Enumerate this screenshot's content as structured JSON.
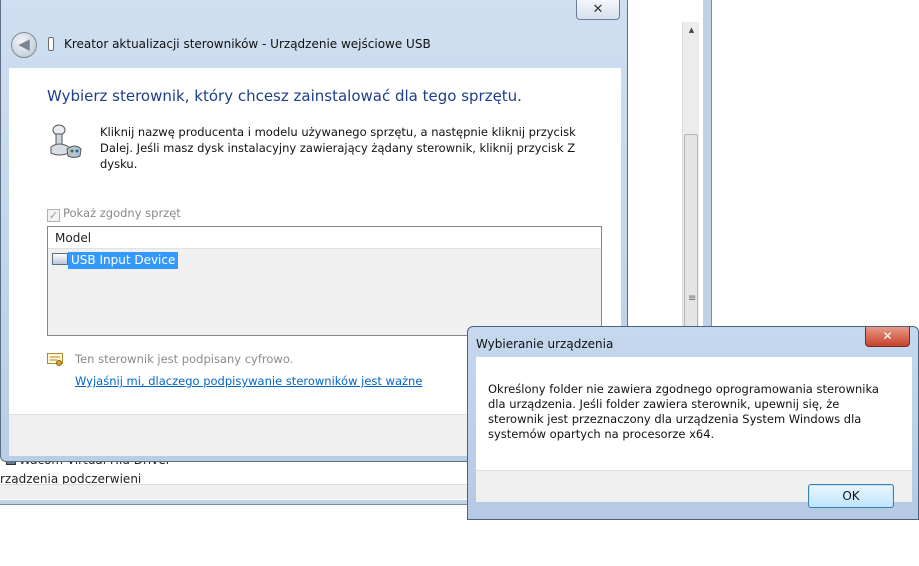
{
  "background_window": {
    "row_1": "Wacom Virtual Hid Driver",
    "row_2": "rządzenia podczerwieni",
    "scroll_up": "▲",
    "scroll_grip": "≡"
  },
  "wizard": {
    "title": "Kreator aktualizacji sterowników - Urządzenie wejściowe USB",
    "close_glyph": "✕",
    "back_glyph": "◀",
    "heading": "Wybierz sterownik, który chcesz zainstalować dla tego sprzętu.",
    "instructions": "Kliknij nazwę producenta i modelu używanego sprzętu, a następnie kliknij przycisk Dalej. Jeśli masz dysk instalacyjny zawierający żądany sterownik, kliknij przycisk Z dysku.",
    "compatible_checkbox_label": "Pokaż zgodny sprzęt",
    "compatible_checked_glyph": "✓",
    "model_list": {
      "header": "Model",
      "items": [
        "USB Input Device"
      ]
    },
    "signed_text": "Ten sterownik jest podpisany cyfrowo.",
    "signing_link": "Wyjaśnij mi, dlaczego podpisywanie sterowników jest ważne"
  },
  "dialog": {
    "title": "Wybieranie urządzenia",
    "close_glyph": "✕",
    "message": "Określony folder nie zawiera zgodnego oprogramowania sterownika dla urządzenia. Jeśli folder zawiera sterownik, upewnij się, że sterownik jest przeznaczony dla urządzenia System Windows dla systemów opartych na procesorze x64.",
    "ok_label": "OK"
  },
  "colors": {
    "heading": "#1d3f8a",
    "link": "#0066cc",
    "selection": "#3399ff",
    "close_button_red": "#c6422b"
  }
}
